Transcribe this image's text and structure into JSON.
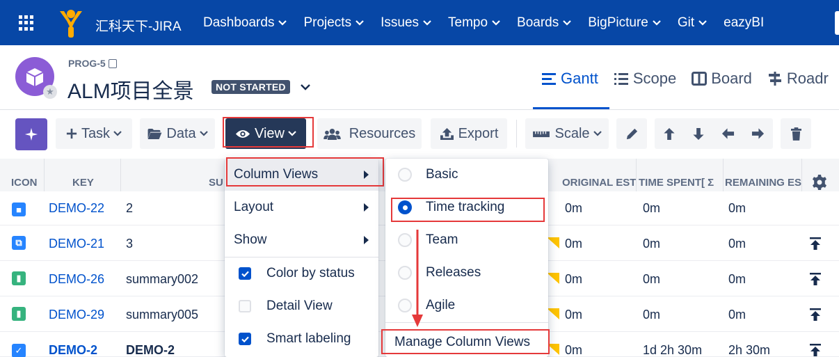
{
  "topnav": {
    "brand": "汇科天下-JIRA",
    "items": [
      {
        "label": "Dashboards"
      },
      {
        "label": "Projects"
      },
      {
        "label": "Issues"
      },
      {
        "label": "Tempo"
      },
      {
        "label": "Boards"
      },
      {
        "label": "BigPicture"
      },
      {
        "label": "Git"
      },
      {
        "label": "eazyBI"
      }
    ]
  },
  "project": {
    "key": "PROG-5",
    "title": "ALM项目全景",
    "status": "NOT STARTED"
  },
  "view_tabs": [
    {
      "label": "Gantt",
      "icon": "gantt-icon",
      "active": true
    },
    {
      "label": "Scope",
      "icon": "list-icon"
    },
    {
      "label": "Board",
      "icon": "board-icon"
    },
    {
      "label": "Roadr",
      "icon": "roadmap-icon"
    }
  ],
  "toolbar": {
    "task_label": "Task",
    "data_label": "Data",
    "view_label": "View",
    "resources_label": "Resources",
    "export_label": "Export",
    "scale_label": "Scale"
  },
  "table": {
    "headers": {
      "icon": "ICON",
      "key": "KEY",
      "summary": "SU",
      "original_est": "ORIGINAL EST",
      "time_spent": "TIME SPENT[ Σ",
      "remaining": "REMAINING ES"
    },
    "rows": [
      {
        "key": "DEMO-22",
        "summary": "2",
        "orig": "0m",
        "spent": "0m",
        "remaining": "0m",
        "type_color": "#2684ff",
        "type_glyph": "■"
      },
      {
        "key": "DEMO-21",
        "summary": "3",
        "orig": "0m",
        "spent": "0m",
        "remaining": "0m",
        "type_color": "#2684ff",
        "type_glyph": "⧉"
      },
      {
        "key": "DEMO-26",
        "summary": "summary002",
        "orig": "0m",
        "spent": "0m",
        "remaining": "0m",
        "type_color": "#36b37e",
        "type_glyph": "▮"
      },
      {
        "key": "DEMO-29",
        "summary": "summary005",
        "orig": "0m",
        "spent": "0m",
        "remaining": "0m",
        "type_color": "#36b37e",
        "type_glyph": "▮"
      },
      {
        "key": "DEMO-2",
        "summary": "DEMO-2",
        "orig": "0m",
        "spent": "1d 2h 30m",
        "remaining": "2h 30m",
        "type_color": "#2684ff",
        "type_glyph": "✓"
      }
    ]
  },
  "view_menu": {
    "column_views": "Column Views",
    "layout": "Layout",
    "show": "Show",
    "color_by_status": "Color by status",
    "detail_view": "Detail View",
    "smart_labeling": "Smart labeling"
  },
  "column_views_menu": {
    "basic": "Basic",
    "time_tracking": "Time tracking",
    "team": "Team",
    "releases": "Releases",
    "agile": "Agile",
    "manage": "Manage Column Views"
  },
  "colors": {
    "nav_bg": "#0747a6",
    "accent": "#0052cc",
    "highlight": "#e5393a",
    "logo": "#ffab00"
  }
}
